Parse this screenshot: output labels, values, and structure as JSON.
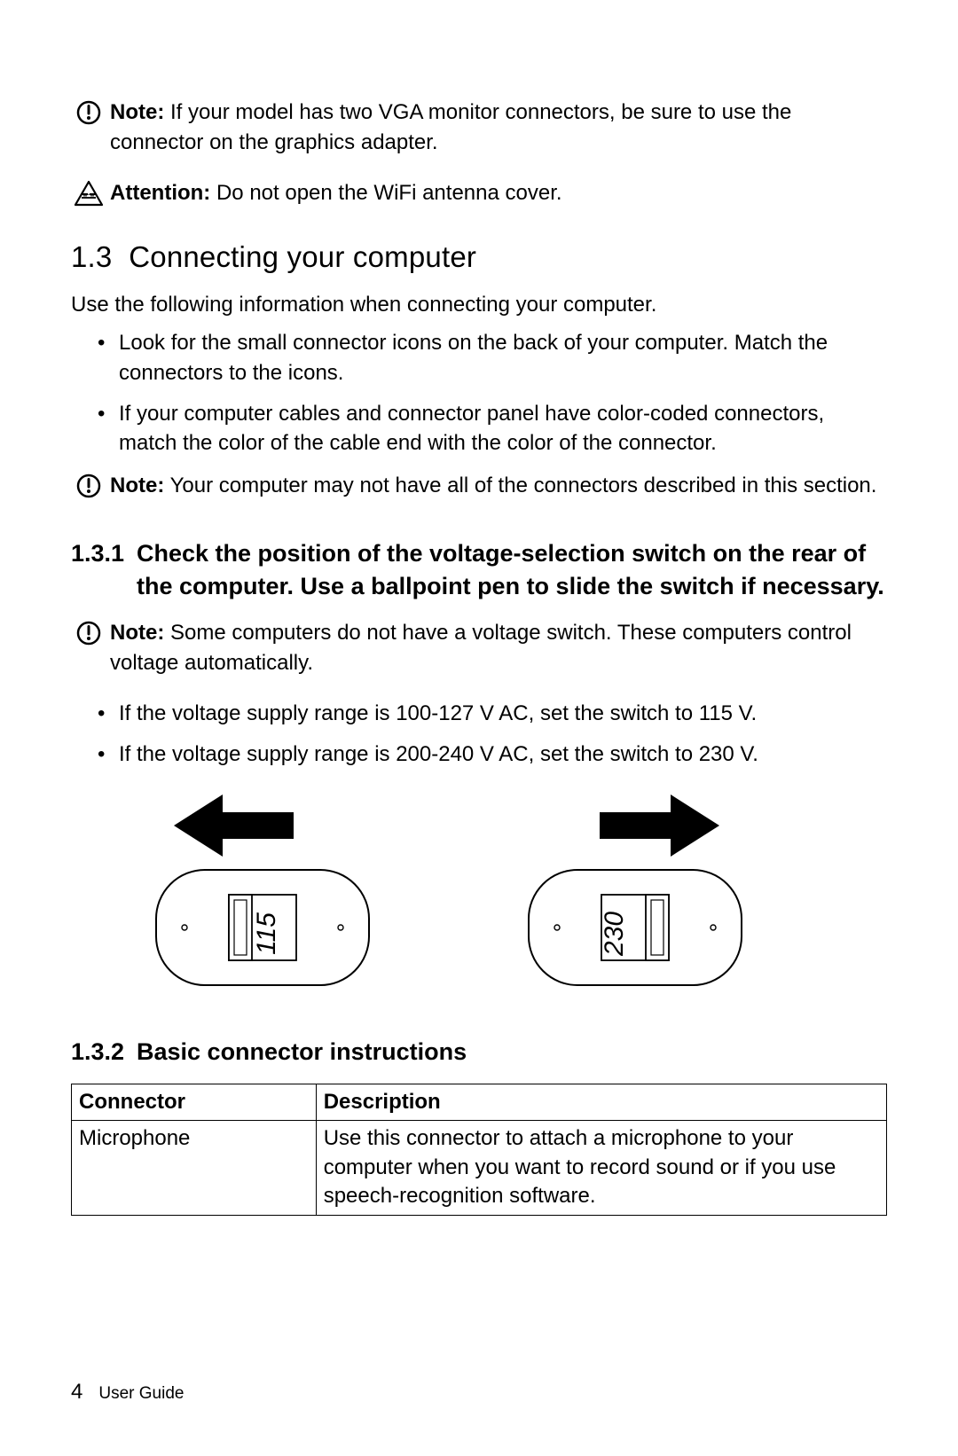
{
  "callouts": {
    "note1_label": "Note:",
    "note1_text": " If your model has two VGA monitor connectors, be sure to use the connector on the graphics adapter.",
    "attention_label": "Attention:",
    "attention_text": " Do not open the WiFi antenna cover.",
    "note2_label": "Note:",
    "note2_text": " Your computer may not have all of the connectors described in this section.",
    "note3_label": "Note:",
    "note3_text": " Some computers do not have a voltage switch. These computers control voltage automatically."
  },
  "section": {
    "num": "1.3",
    "title": "Connecting your computer",
    "intro": "Use the following information when connecting your computer.",
    "bullets_a": [
      "Look for the small connector icons on the back of your computer. Match the connectors to the icons.",
      "If your computer cables and connector panel have color-coded connectors, match the color of the cable end with the color of the connector."
    ]
  },
  "sub1": {
    "num": "1.3.1",
    "title": "Check the position of the voltage-selection switch on the rear of the computer. Use a ballpoint pen to slide the switch if necessary.",
    "bullets": [
      "If the voltage supply range is 100-127 V AC, set the switch to 115 V.",
      "If the voltage supply range is 200-240 V AC, set the switch to 230 V."
    ],
    "switch_left_label": "115",
    "switch_right_label": "230"
  },
  "sub2": {
    "num": "1.3.2",
    "title": "Basic connector instructions",
    "table": {
      "h1": "Connector",
      "h2": "Description",
      "r1c1": "Microphone",
      "r1c2": "Use this connector to attach a microphone to your computer when you want to record sound or if you use speech-recognition software."
    }
  },
  "footer": {
    "page_number": "4",
    "doc_title": "User Guide"
  }
}
